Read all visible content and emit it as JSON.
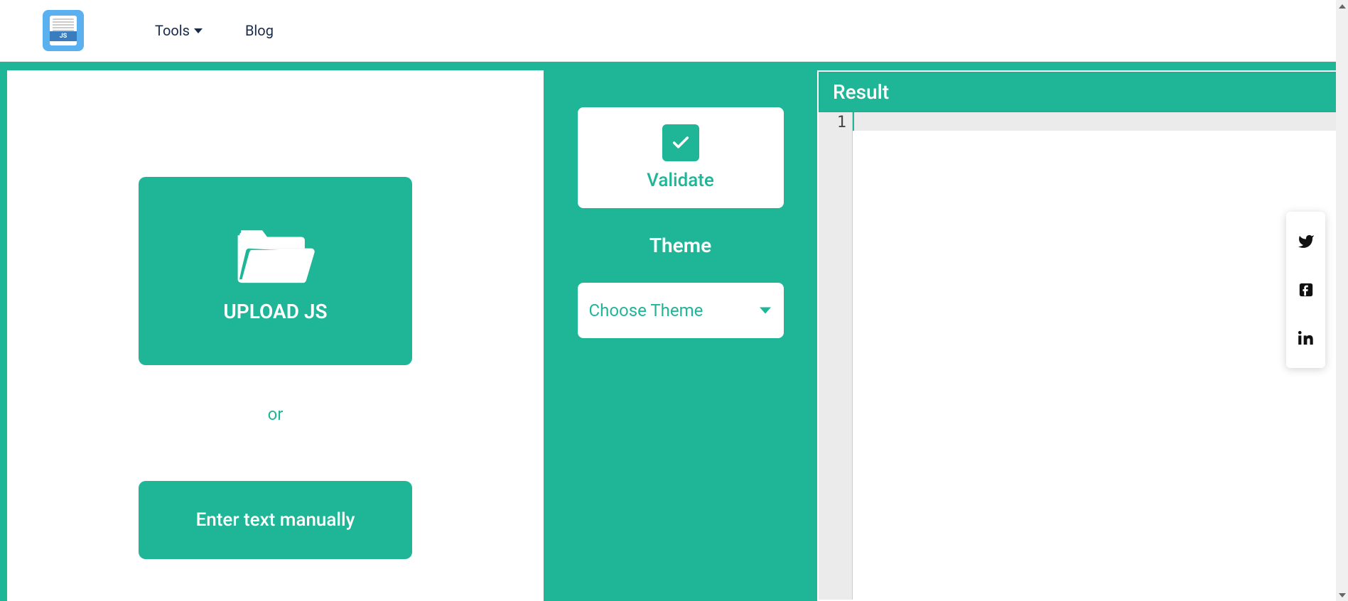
{
  "header": {
    "nav": {
      "tools": "Tools",
      "blog": "Blog"
    }
  },
  "upload": {
    "upload_label": "UPLOAD JS",
    "or_text": "or",
    "enter_text_label": "Enter text manually"
  },
  "controls": {
    "validate_label": "Validate",
    "theme_heading": "Theme",
    "theme_select_label": "Choose Theme"
  },
  "result": {
    "heading": "Result",
    "line_number": "1"
  }
}
